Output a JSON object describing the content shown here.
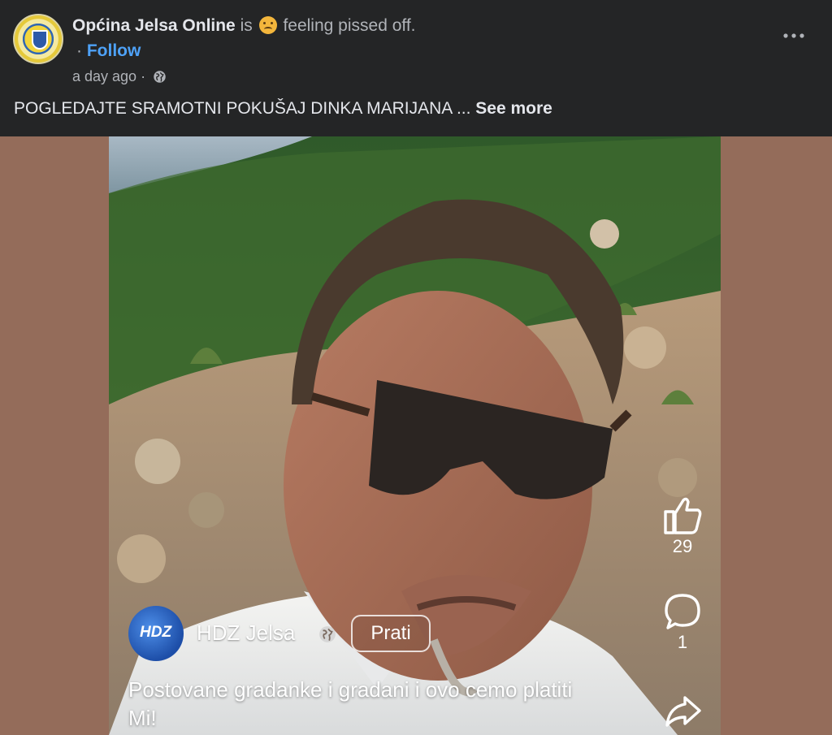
{
  "post": {
    "author": "Općina Jelsa Online",
    "is_text": "is",
    "feeling_text": "feeling pissed off.",
    "follow_prefix": "·",
    "follow_label": "Follow",
    "timestamp": "a day ago",
    "time_separator": "·",
    "body_text": "POGLEDAJTE SRAMOTNI POKUŠAJ DINKA MARIJANA ...",
    "see_more_label": "See more"
  },
  "video": {
    "channel_name": "HDZ Jelsa",
    "channel_avatar_text": "HDZ",
    "follow_button": "Prati",
    "caption": "Postovane gradanke i gradani i ovo cemo platiti Mi!",
    "likes": "29",
    "comments": "1"
  },
  "icons": {
    "more": "more-horizontal-icon",
    "privacy": "globe-icon",
    "like": "thumbs-up-icon",
    "comment": "comment-bubble-icon",
    "share": "share-arrow-icon"
  },
  "colors": {
    "background": "#242526",
    "text": "#e4e6eb",
    "muted": "#b0b3b8",
    "link": "#4ea2f8",
    "media_backdrop": "#946c5a"
  }
}
